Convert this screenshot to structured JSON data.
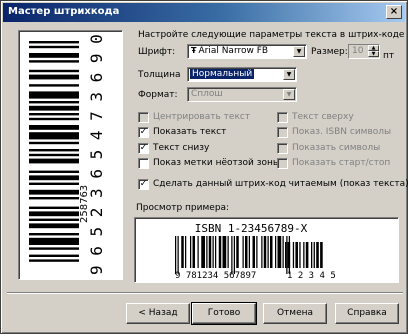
{
  "window": {
    "title": "Мастер штрихкода",
    "close_glyph": "×"
  },
  "vertical_preview": {
    "digits": "9 6 5 2 3 6 5 4 7 3 6 9 0 ,",
    "small_label": "258763"
  },
  "settings": {
    "intro": "Настройте следующие параметры текста в штрих-коде",
    "font_label": "Шрифт:",
    "font_value": "Arial Narrow FB",
    "size_label": "Размер:",
    "size_value": "10",
    "size_unit": "пт",
    "thickness_label": "Толщина",
    "thickness_value": "Нормальный",
    "mode_label": "Формат:",
    "mode_value": "Сплош",
    "checkboxes": [
      {
        "label": "Центрировать текст",
        "checked": false,
        "enabled": false
      },
      {
        "label": "Текст сверху",
        "checked": false,
        "enabled": false
      },
      {
        "label": "Показать текст",
        "checked": true,
        "enabled": true
      },
      {
        "label": "Показ. ISBN символы",
        "checked": false,
        "enabled": false
      },
      {
        "label": "Текст снизу",
        "checked": true,
        "enabled": true
      },
      {
        "label": "Показать символы",
        "checked": false,
        "enabled": false
      },
      {
        "label": "Показ метки нёотзой зоны",
        "checked": false,
        "enabled": true
      },
      {
        "label": "Показать старт/стоп",
        "checked": false,
        "enabled": false
      },
      {
        "label": "Сделать данный штрих-код читаемым (показ текста)",
        "checked": true,
        "enabled": true
      }
    ],
    "preview_label": "Просмотр примера:"
  },
  "sample": {
    "isbn_text": "ISBN 1-23456789-X",
    "main_digits": "9 781234 567897",
    "addon_digits": "1 2 3 4 5"
  },
  "buttons": {
    "back": "< Назад",
    "finish": "Готово",
    "cancel": "Отмена",
    "help": "Справка"
  }
}
